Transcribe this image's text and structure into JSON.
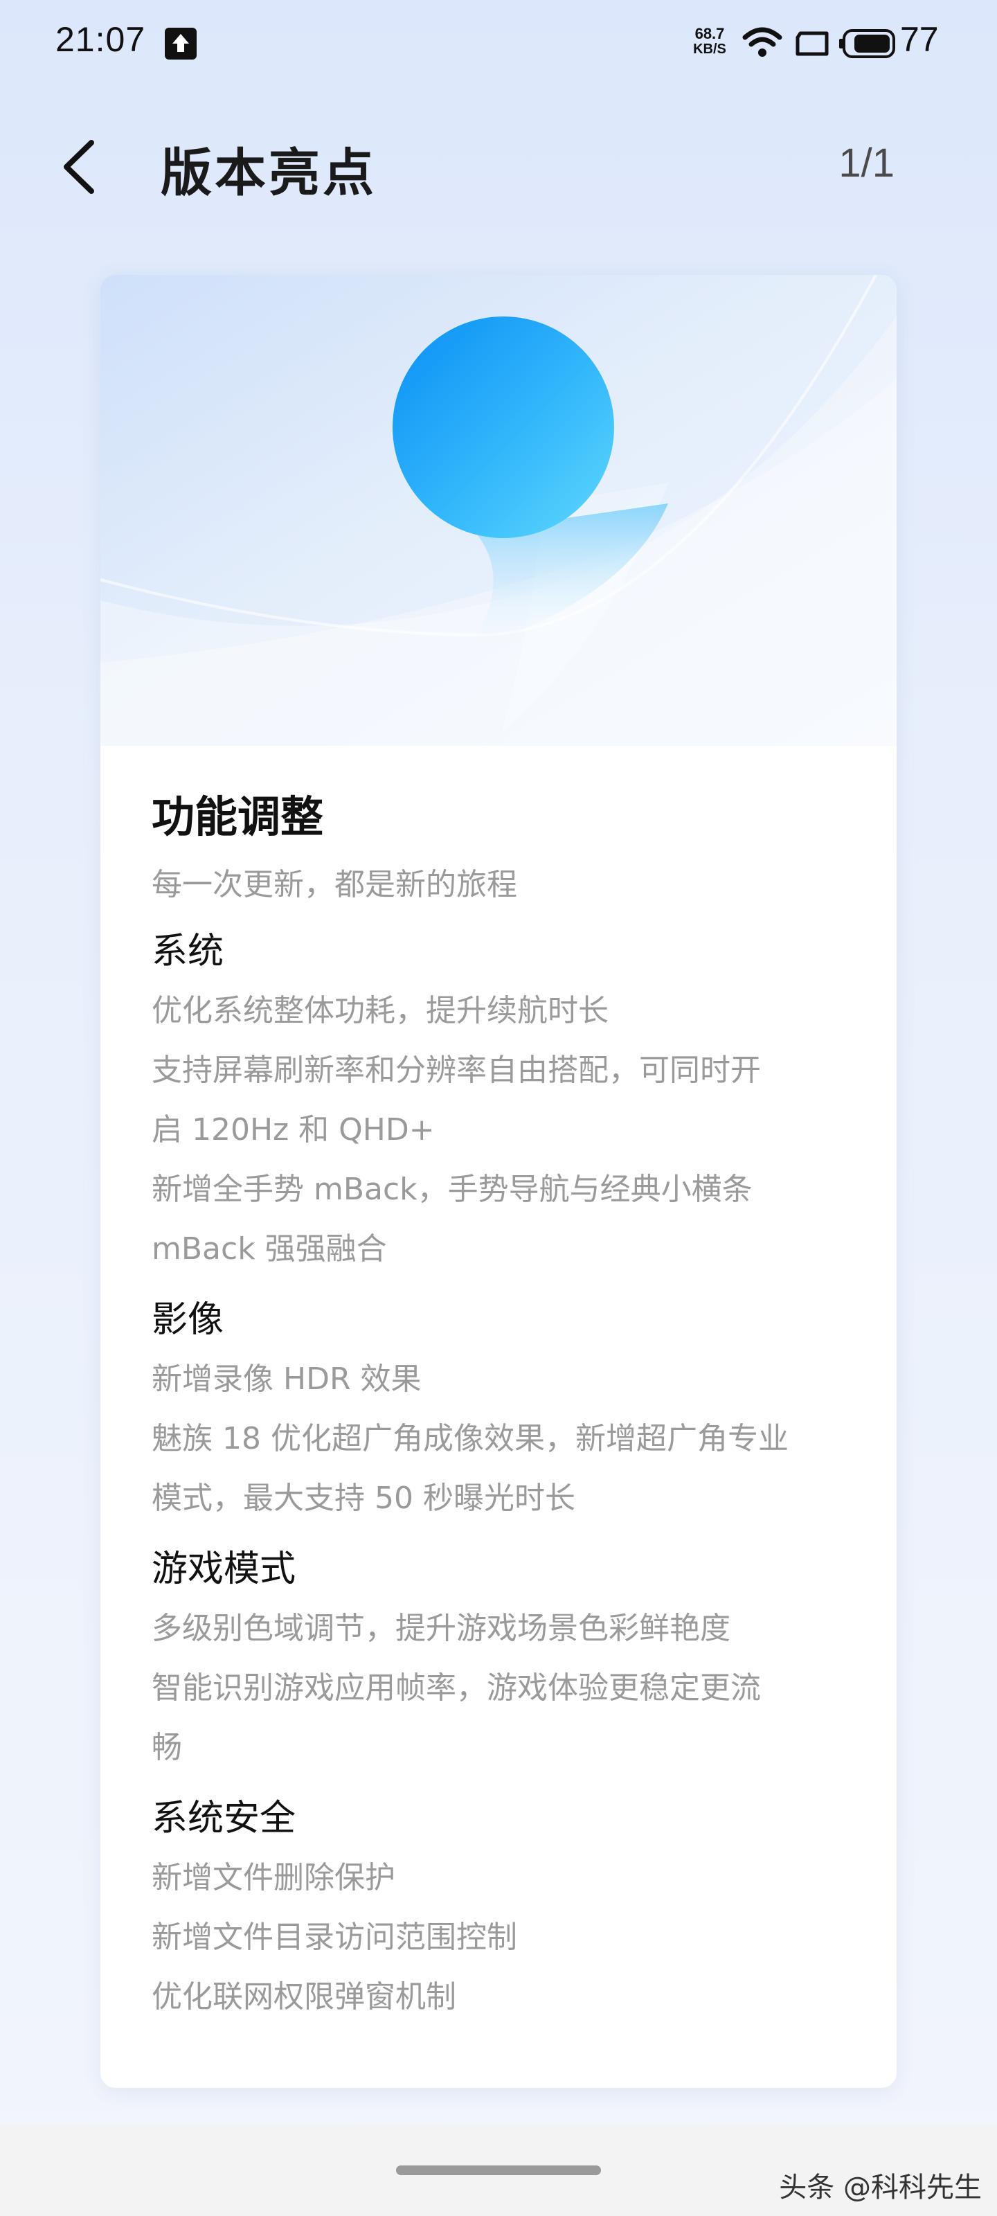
{
  "status_bar": {
    "time": "21:07",
    "net_speed_value": "68.7",
    "net_speed_unit": "KB/S",
    "battery_percent": "77",
    "icons": [
      "upload-icon",
      "wifi-icon",
      "screen-icon",
      "battery-icon"
    ]
  },
  "header": {
    "title": "版本亮点",
    "page_indicator": "1/1",
    "back_icon": "back-chevron-icon"
  },
  "card": {
    "title": "功能调整",
    "subtitle": "每一次更新，都是新的旅程",
    "sections": [
      {
        "title": "系统",
        "items": [
          "优化系统整体功耗，提升续航时长",
          "支持屏幕刷新率和分辨率自由搭配，可同时开",
          "启 120Hz 和 QHD+",
          "新增全手势 mBack，手势导航与经典小横条",
          "mBack 强强融合"
        ]
      },
      {
        "title": "影像",
        "items": [
          "新增录像 HDR 效果",
          "魅族 18 优化超广角成像效果，新增超广角专业",
          "模式，最大支持 50 秒曝光时长"
        ]
      },
      {
        "title": "游戏模式",
        "items": [
          "多级别色域调节，提升游戏场景色彩鲜艳度",
          "智能识别游戏应用帧率，游戏体验更稳定更流",
          "畅"
        ]
      },
      {
        "title": "系统安全",
        "items": [
          "新增文件删除保护",
          "新增文件目录访问范围控制",
          "优化联网权限弹窗机制"
        ]
      }
    ]
  },
  "watermark": "头条 @科科先生",
  "colors": {
    "accent_blue": "#2ba8f6",
    "secondary_text": "#9a9a9a",
    "primary_text": "#111111"
  }
}
